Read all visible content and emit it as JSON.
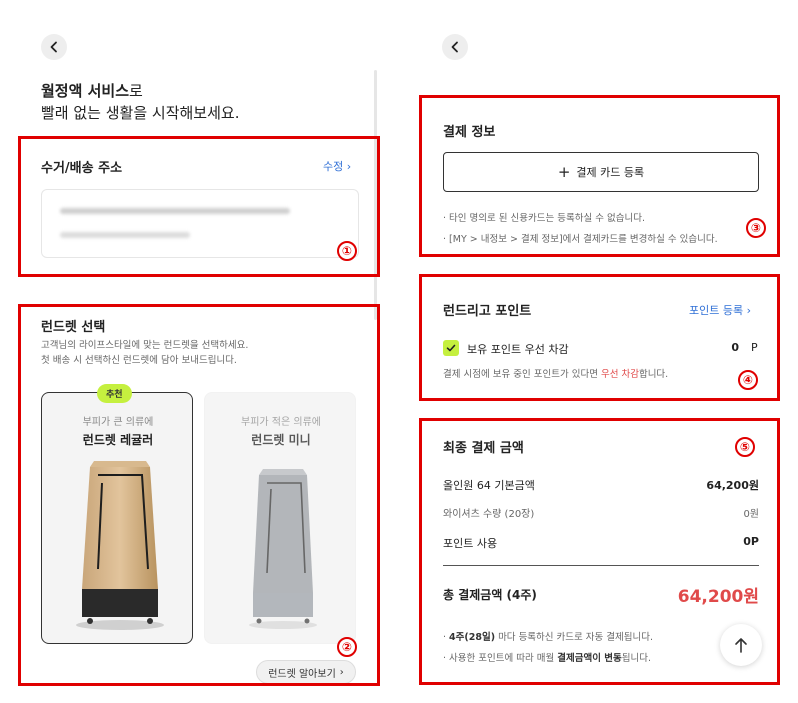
{
  "left": {
    "headline_bold": "월정액 서비스",
    "headline_rest": "로",
    "headline_line2": "빨래 없는 생활을 시작해보세요.",
    "address": {
      "title": "수거/배송 주소",
      "edit_label": "수정 ›"
    },
    "rack": {
      "title": "런드렛 선택",
      "desc_line1": "고객님의 라이프스타일에 맞는 런드렛을 선택하세요.",
      "desc_line2": "첫 배송 시 선택하신 런드렛에 담아 보내드립니다.",
      "products": [
        {
          "badge": "추천",
          "subtitle": "부피가 큰 의류에",
          "name": "런드렛 레귤러"
        },
        {
          "subtitle": "부피가 적은 의류에",
          "name": "런드렛 미니"
        }
      ],
      "learn_more": "런드렛 알아보기"
    }
  },
  "right": {
    "payment": {
      "title": "결제 정보",
      "add_card": "결제 카드 등록",
      "note1": "· 타인 명의로 된 신용카드는 등록하실 수 없습니다.",
      "note2": "· [MY > 내정보 > 결제 정보]에서 결제카드를 변경하실 수 있습니다."
    },
    "points": {
      "title": "런드리고 포인트",
      "register": "포인트 등록 ›",
      "checkbox_label": "보유 포인트 우선 차감",
      "point_value": "0",
      "point_unit": "P",
      "note_pre": "결제 시점에 보유 중인 포인트가 있다면 ",
      "note_highlight": "우선 차감",
      "note_post": "합니다."
    },
    "final": {
      "title": "최종 결제 금액",
      "rows": [
        {
          "label": "올인원 64 기본금액",
          "value": "64,200원"
        },
        {
          "label": "와이셔츠 수량 (20장)",
          "value": "0원"
        },
        {
          "label": "포인트 사용",
          "value": "0P"
        }
      ],
      "total_label": "총 결제금액 (4주)",
      "total_value": "64,200원",
      "note1_bold": "4주(28일)",
      "note1_rest": " 마다 등록하신 카드로 자동 결제됩니다.",
      "note2_pre": "· 사용한 포인트에 따라 매월 ",
      "note2_bold": "결제금액이 변동",
      "note2_post": "됩니다.",
      "note1_prefix": "· "
    }
  },
  "annotations": [
    "①",
    "②",
    "③",
    "④",
    "⑤"
  ],
  "colors": {
    "annotation": "#e00000",
    "accent_green": "#c5f03f",
    "link_blue": "#2f6fd6",
    "price_red": "#e04a4a"
  },
  "icons": [
    "back-chevron-icon",
    "plus-icon",
    "check-icon",
    "arrow-up-icon",
    "chevron-right-icon"
  ]
}
